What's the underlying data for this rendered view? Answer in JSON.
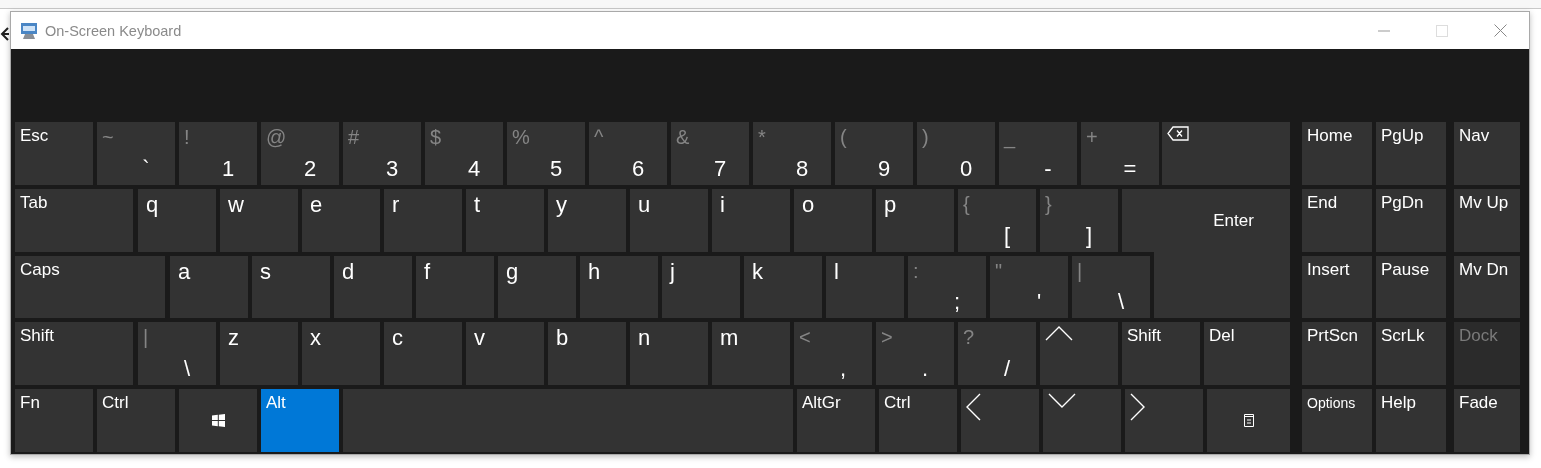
{
  "window": {
    "title": "On-Screen Keyboard"
  },
  "keyboard": {
    "rows": [
      {
        "keys": [
          {
            "kind": "label",
            "label": "Esc",
            "on": false,
            "disabled": false
          },
          {
            "kind": "dual",
            "shift": "~",
            "label": "`",
            "on": false,
            "disabled": false
          },
          {
            "kind": "dual",
            "shift": "!",
            "label": "1",
            "on": false,
            "disabled": false
          },
          {
            "kind": "dual",
            "shift": "@",
            "label": "2",
            "on": false,
            "disabled": false
          },
          {
            "kind": "dual",
            "shift": "#",
            "label": "3",
            "on": false,
            "disabled": false
          },
          {
            "kind": "dual",
            "shift": "$",
            "label": "4",
            "on": false,
            "disabled": false
          },
          {
            "kind": "dual",
            "shift": "%",
            "label": "5",
            "on": false,
            "disabled": false
          },
          {
            "kind": "dual",
            "shift": "^",
            "label": "6",
            "on": false,
            "disabled": false
          },
          {
            "kind": "dual",
            "shift": "&",
            "label": "7",
            "on": false,
            "disabled": false
          },
          {
            "kind": "dual",
            "shift": "*",
            "label": "8",
            "on": false,
            "disabled": false
          },
          {
            "kind": "dual",
            "shift": "(",
            "label": "9",
            "on": false,
            "disabled": false
          },
          {
            "kind": "dual",
            "shift": ")",
            "label": "0",
            "on": false,
            "disabled": false
          },
          {
            "kind": "dual",
            "shift": "_",
            "label": "-",
            "on": false,
            "disabled": false
          },
          {
            "kind": "dual",
            "shift": "+",
            "label": "=",
            "on": false,
            "disabled": false
          },
          {
            "kind": "backspace",
            "on": false,
            "disabled": false
          }
        ]
      },
      {
        "keys": [
          {
            "kind": "label",
            "label": "Tab",
            "on": false,
            "disabled": false
          },
          {
            "kind": "letter",
            "label": "q",
            "on": false,
            "disabled": false
          },
          {
            "kind": "letter",
            "label": "w",
            "on": false,
            "disabled": false
          },
          {
            "kind": "letter",
            "label": "e",
            "on": false,
            "disabled": false
          },
          {
            "kind": "letter",
            "label": "r",
            "on": false,
            "disabled": false
          },
          {
            "kind": "letter",
            "label": "t",
            "on": false,
            "disabled": false
          },
          {
            "kind": "letter",
            "label": "y",
            "on": false,
            "disabled": false
          },
          {
            "kind": "letter",
            "label": "u",
            "on": false,
            "disabled": false
          },
          {
            "kind": "letter",
            "label": "i",
            "on": false,
            "disabled": false
          },
          {
            "kind": "letter",
            "label": "o",
            "on": false,
            "disabled": false
          },
          {
            "kind": "letter",
            "label": "p",
            "on": false,
            "disabled": false
          },
          {
            "kind": "dual",
            "shift": "{",
            "label": "[",
            "on": false,
            "disabled": false
          },
          {
            "kind": "dual",
            "shift": "}",
            "label": "]",
            "on": false,
            "disabled": false
          },
          {
            "kind": "enter",
            "label": "Enter",
            "on": false,
            "disabled": false
          }
        ]
      },
      {
        "keys": [
          {
            "kind": "label",
            "label": "Caps",
            "on": false,
            "disabled": false
          },
          {
            "kind": "letter",
            "label": "a",
            "on": false,
            "disabled": false
          },
          {
            "kind": "letter",
            "label": "s",
            "on": false,
            "disabled": false
          },
          {
            "kind": "letter",
            "label": "d",
            "on": false,
            "disabled": false
          },
          {
            "kind": "letter",
            "label": "f",
            "on": false,
            "disabled": false
          },
          {
            "kind": "letter",
            "label": "g",
            "on": false,
            "disabled": false
          },
          {
            "kind": "letter",
            "label": "h",
            "on": false,
            "disabled": false
          },
          {
            "kind": "letter",
            "label": "j",
            "on": false,
            "disabled": false
          },
          {
            "kind": "letter",
            "label": "k",
            "on": false,
            "disabled": false
          },
          {
            "kind": "letter",
            "label": "l",
            "on": false,
            "disabled": false
          },
          {
            "kind": "dual",
            "shift": ":",
            "label": ";",
            "on": false,
            "disabled": false
          },
          {
            "kind": "dual",
            "shift": "\"",
            "label": "'",
            "on": false,
            "disabled": false
          },
          {
            "kind": "dual",
            "shift": "|",
            "label": "\\",
            "on": false,
            "disabled": false
          }
        ]
      },
      {
        "keys": [
          {
            "kind": "label",
            "label": "Shift",
            "on": false,
            "disabled": false
          },
          {
            "kind": "dual",
            "shift": "|",
            "label": "\\",
            "on": false,
            "disabled": false
          },
          {
            "kind": "letter",
            "label": "z",
            "on": false,
            "disabled": false
          },
          {
            "kind": "letter",
            "label": "x",
            "on": false,
            "disabled": false
          },
          {
            "kind": "letter",
            "label": "c",
            "on": false,
            "disabled": false
          },
          {
            "kind": "letter",
            "label": "v",
            "on": false,
            "disabled": false
          },
          {
            "kind": "letter",
            "label": "b",
            "on": false,
            "disabled": false
          },
          {
            "kind": "letter",
            "label": "n",
            "on": false,
            "disabled": false
          },
          {
            "kind": "letter",
            "label": "m",
            "on": false,
            "disabled": false
          },
          {
            "kind": "dual",
            "shift": "<",
            "label": ",",
            "on": false,
            "disabled": false
          },
          {
            "kind": "dual",
            "shift": ">",
            "label": ".",
            "on": false,
            "disabled": false
          },
          {
            "kind": "dual",
            "shift": "?",
            "label": "/",
            "on": false,
            "disabled": false
          },
          {
            "kind": "up",
            "on": false,
            "disabled": false
          },
          {
            "kind": "label",
            "label": "Shift",
            "on": false,
            "disabled": false
          },
          {
            "kind": "label",
            "label": "Del",
            "on": false,
            "disabled": false
          }
        ]
      },
      {
        "keys": [
          {
            "kind": "label",
            "label": "Fn",
            "on": false,
            "disabled": false
          },
          {
            "kind": "label",
            "label": "Ctrl",
            "on": false,
            "disabled": false
          },
          {
            "kind": "windows",
            "on": false,
            "disabled": false
          },
          {
            "kind": "label",
            "label": "Alt",
            "on": true,
            "disabled": false
          },
          {
            "kind": "space",
            "on": false
          },
          {
            "kind": "label",
            "label": "AltGr",
            "on": false,
            "disabled": false
          },
          {
            "kind": "label",
            "label": "Ctrl",
            "on": false,
            "disabled": false
          },
          {
            "kind": "left",
            "on": false,
            "disabled": false
          },
          {
            "kind": "down",
            "on": false,
            "disabled": false
          },
          {
            "kind": "right",
            "on": false,
            "disabled": false
          },
          {
            "kind": "menu",
            "on": false,
            "disabled": false
          }
        ]
      }
    ],
    "side_rows": [
      {
        "keys": [
          {
            "kind": "label",
            "label": "Home",
            "on": false,
            "disabled": false
          },
          {
            "kind": "label",
            "label": "PgUp",
            "on": false,
            "disabled": false
          },
          {
            "kind": "label",
            "label": "Nav",
            "on": false,
            "disabled": false
          }
        ]
      },
      {
        "keys": [
          {
            "kind": "label",
            "label": "End",
            "on": false,
            "disabled": false
          },
          {
            "kind": "label",
            "label": "PgDn",
            "on": false,
            "disabled": false
          },
          {
            "kind": "label",
            "label": "Mv Up",
            "on": false,
            "disabled": false
          }
        ]
      },
      {
        "keys": [
          {
            "kind": "label",
            "label": "Insert",
            "on": false,
            "disabled": false
          },
          {
            "kind": "label",
            "label": "Pause",
            "on": false,
            "disabled": false
          },
          {
            "kind": "label",
            "label": "Mv Dn",
            "on": false,
            "disabled": false
          }
        ]
      },
      {
        "keys": [
          {
            "kind": "label",
            "label": "PrtScn",
            "on": false,
            "disabled": false
          },
          {
            "kind": "label",
            "label": "ScrLk",
            "on": false,
            "disabled": false
          },
          {
            "kind": "label",
            "label": "Dock",
            "on": false,
            "disabled": true
          }
        ]
      },
      {
        "keys": [
          {
            "kind": "small",
            "label": "Options",
            "on": false,
            "disabled": false
          },
          {
            "kind": "label",
            "label": "Help",
            "on": false,
            "disabled": false
          },
          {
            "kind": "label",
            "label": "Fade",
            "on": false,
            "disabled": false
          }
        ]
      }
    ]
  }
}
